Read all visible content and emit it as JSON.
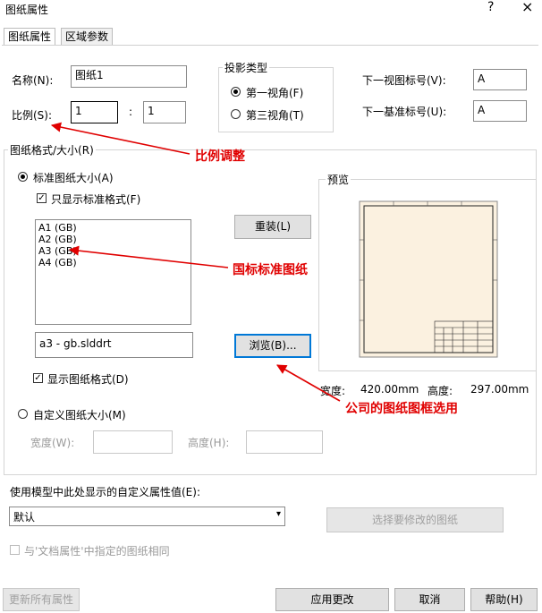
{
  "window": {
    "title": "图纸属性",
    "help": "?",
    "close": "×"
  },
  "tabs": [
    {
      "label": "图纸属性"
    },
    {
      "label": "区域参数"
    }
  ],
  "name": {
    "label": "名称(N):",
    "value": "图纸1"
  },
  "scale": {
    "label": "比例(S):",
    "value1": "1",
    "separator": ":",
    "value2": "1"
  },
  "projection": {
    "title": "投影类型",
    "first": "第一视角(F)",
    "third": "第三视角(T)",
    "selected": "first"
  },
  "next_view": {
    "label": "下一视图标号(V):",
    "value": "A"
  },
  "next_datum": {
    "label": "下一基准标号(U):",
    "value": "A"
  },
  "format_group": {
    "title": "图纸格式/大小(R)"
  },
  "standard": {
    "label": "标准图纸大小(A)",
    "only_std_label": "只显示标准格式(F)"
  },
  "sheet_list": [
    "A1 (GB)",
    "A2 (GB)",
    "A3 (GB)",
    "A4 (GB)"
  ],
  "reload_label": "重装(L)",
  "file_value": "a3 - gb.slddrt",
  "browse_label": "浏览(B)...",
  "show_format_label": "显示图纸格式(D)",
  "custom": {
    "label": "自定义图纸大小(M)",
    "width_label": "宽度(W):",
    "height_label": "高度(H):"
  },
  "preview": {
    "title": "预览",
    "width_label": "宽度:",
    "width_value": "420.00mm",
    "height_label": "高度:",
    "height_value": "297.00mm"
  },
  "props_label": "使用模型中此处显示的自定义属性值(E):",
  "props_select": "默认",
  "select_sheet_label": "选择要修改的图纸",
  "same_as_doc_label": "与'文档属性'中指定的图纸相同",
  "footer": {
    "update_all": "更新所有属性",
    "apply": "应用更改",
    "cancel": "取消",
    "help": "帮助(H)"
  },
  "annotations": {
    "scale_adjust": "比例调整",
    "gb_standard": "国标标准图纸",
    "company_frame": "公司的图纸图框选用"
  },
  "colors": {
    "annotation": "#e00000",
    "preview_paper": "#fbf1e0",
    "focus": "#0078d7"
  }
}
